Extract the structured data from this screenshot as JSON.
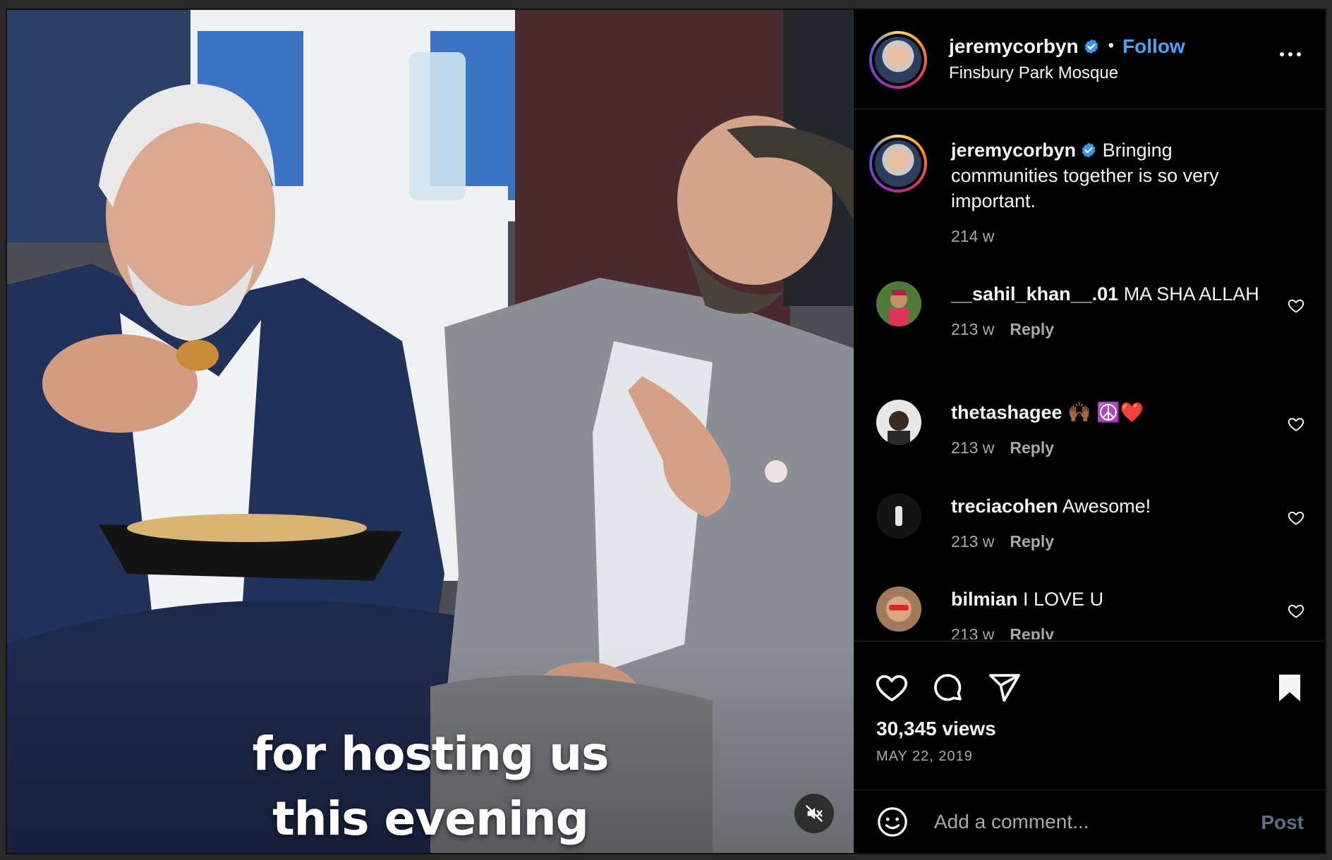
{
  "post": {
    "username": "jeremycorbyn",
    "separator": "•",
    "follow_label": "Follow",
    "location": "Finsbury Park Mosque",
    "verified": true
  },
  "video": {
    "caption_line1": "for hosting us",
    "caption_line2": "this evening",
    "muted": true
  },
  "caption": {
    "username": "jeremycorbyn",
    "text": "Bringing communities together is so very important.",
    "age": "214 w"
  },
  "comments": [
    {
      "username": "__sahil_khan__.01",
      "text": "MA SHA ALLAH",
      "age": "213 w",
      "reply_label": "Reply"
    },
    {
      "username": "thetashagee",
      "text": "🙌🏾 ☮️❤️",
      "age": "213 w",
      "reply_label": "Reply"
    },
    {
      "username": "treciacohen",
      "text": "Awesome!",
      "age": "213 w",
      "reply_label": "Reply"
    },
    {
      "username": "bilmian",
      "text": "I LOVE U",
      "age": "213 w",
      "reply_label": "Reply"
    }
  ],
  "stats": {
    "views": "30,345 views",
    "date": "MAY 22, 2019"
  },
  "composer": {
    "placeholder": "Add a comment...",
    "post_label": "Post"
  },
  "colors": {
    "background": "#000000",
    "accent": "#4aa3f7",
    "muted_text": "#a8a8a8",
    "divider": "#262626"
  },
  "icons": [
    "verified-badge-icon",
    "more-options-icon",
    "heart-icon",
    "comment-icon",
    "share-icon",
    "bookmark-icon",
    "emoji-icon",
    "muted-speaker-icon"
  ]
}
